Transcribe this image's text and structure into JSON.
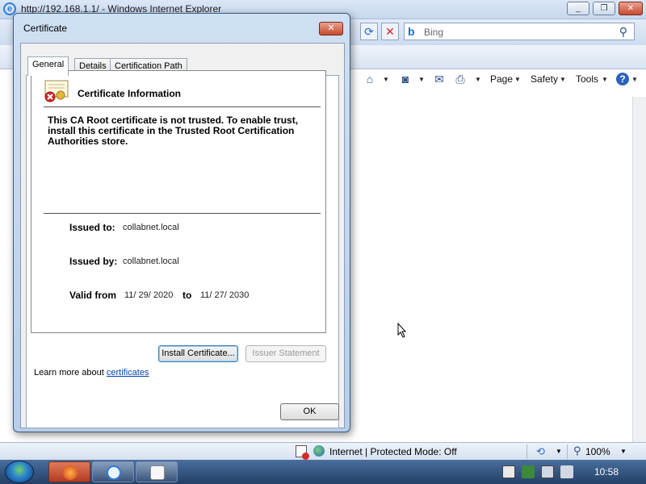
{
  "browser": {
    "title": "http://192.168.1.1/ - Windows Internet Explorer",
    "search_placeholder": "Bing",
    "toolbar": {
      "page_label": "Page",
      "safety_label": "Safety",
      "tools_label": "Tools"
    },
    "status": {
      "zone": "Internet | Protected Mode: Off",
      "zoom": "100%"
    }
  },
  "dialog": {
    "title": "Certificate",
    "tabs": [
      {
        "label": "General"
      },
      {
        "label": "Details"
      },
      {
        "label": "Certification Path"
      }
    ],
    "info_title": "Certificate Information",
    "warning": "This CA Root certificate is not trusted. To enable trust, install this certificate in the Trusted Root Certification Authorities store.",
    "issued_to_label": "Issued to:",
    "issued_to": "collabnet.local",
    "issued_by_label": "Issued by:",
    "issued_by": "collabnet.local",
    "valid_from_label": "Valid from",
    "valid_from": "11/ 29/ 2020",
    "valid_to_label": "to",
    "valid_to": "11/ 27/ 2030",
    "install_button": "Install Certificate...",
    "issuer_statement_button": "Issuer Statement",
    "learn_more_prefix": "Learn more about",
    "learn_more_link": "certificates",
    "ok_button": "OK"
  },
  "taskbar": {
    "clock": "10:58"
  }
}
